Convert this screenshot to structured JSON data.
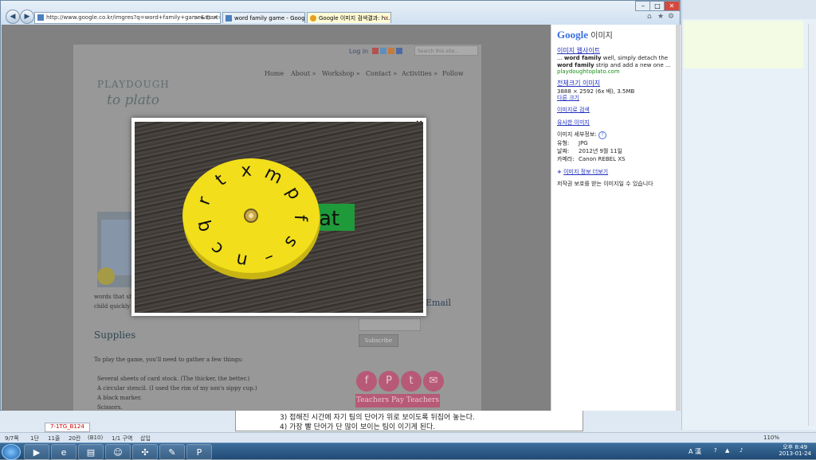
{
  "browser": {
    "address": "http://www.google.co.kr/imgres?q=word+family+game&start=",
    "tabs": [
      {
        "label": "word family game - Google ..."
      },
      {
        "label": "Google 이미지 검색결과: h..."
      }
    ]
  },
  "site": {
    "login": "Log in",
    "search_placeholder": "Search this site...",
    "logo_line1": "PLAYDOUGH",
    "logo_line2": "to plato",
    "nav": [
      "Home",
      "About »",
      "Workshop »",
      "Contact »",
      "Activities »",
      "Follow"
    ],
    "para1": "words that sha",
    "para2": "child quickly u",
    "supplies_heading": "Supplies",
    "supplies_intro": "To play the game, you'll need to gather a few things:",
    "supplies_list": [
      "Several sheets of card stock. (The thicker, the better.)",
      "A circular stencil. (I used the rim of my son's sippy cup.)",
      "A black marker.",
      "Scissors."
    ],
    "email_heading": "Email",
    "subscribe_label": "Subscribe",
    "social_glyphs": [
      "f",
      "P",
      "t",
      "✉"
    ],
    "tpt_label": "Teachers Pay Teachers"
  },
  "lightbox": {
    "close_label": "×",
    "wheel_letters": [
      "p",
      "f",
      "s",
      "–",
      "n",
      "c",
      "q",
      "r",
      "t",
      "x",
      "m"
    ],
    "strip_text": "at"
  },
  "infopanel": {
    "google_label": "Google",
    "images_label": "이미지",
    "site_link": "이미지 웹사이트",
    "snippet_pre": "... ",
    "snippet_b1": "word family",
    "snippet_mid": " well, simply detach the ",
    "snippet_b2": "word family",
    "snippet_post": " strip and add a new one ...",
    "domain": "playdoughtoplato.com",
    "fullsize_link": "전체크기 이미지",
    "fullsize_info": "3888 × 2592 (6x 배), 3.5MB",
    "other_sizes": "다른 크기",
    "search_by_image": "이미지로 검색",
    "similar_images": "유사한 이미지",
    "details_heading": "이미지 세부정보:",
    "details": [
      {
        "label": "유형:",
        "value": "JPG"
      },
      {
        "label": "날짜:",
        "value": "2012년 9월 11일"
      },
      {
        "label": "카메라:",
        "value": "Canon REBEL XS"
      }
    ],
    "more_info": "이미지 정보 더보기",
    "copyright": "저작권 보호를 받는 이미지일 수 있습니다"
  },
  "bgapp": {
    "doc_line1": "3) 접해진 시간에 자기 팀의 단어가 위로 보이도록 뒤집어 놓는다.",
    "doc_line2": "4) 가장 빨 단어가 단 많이 보이는 팀이 이기게 된다.",
    "doc_tab": "7-1TG_B124",
    "status_items": [
      "9/7쪽",
      "1단",
      "11줄",
      "20칸",
      "(B10)",
      "1/1 구역",
      "삽입"
    ],
    "zoom": "110%"
  },
  "taskbar": {
    "time": "오후 8:49",
    "date": "2013-01-24",
    "ime": "A 漢"
  },
  "colors": {
    "wheel_yellow": "#f2de1a",
    "strip_green": "#1f9a3a",
    "link_blue": "#1f2fbf"
  }
}
